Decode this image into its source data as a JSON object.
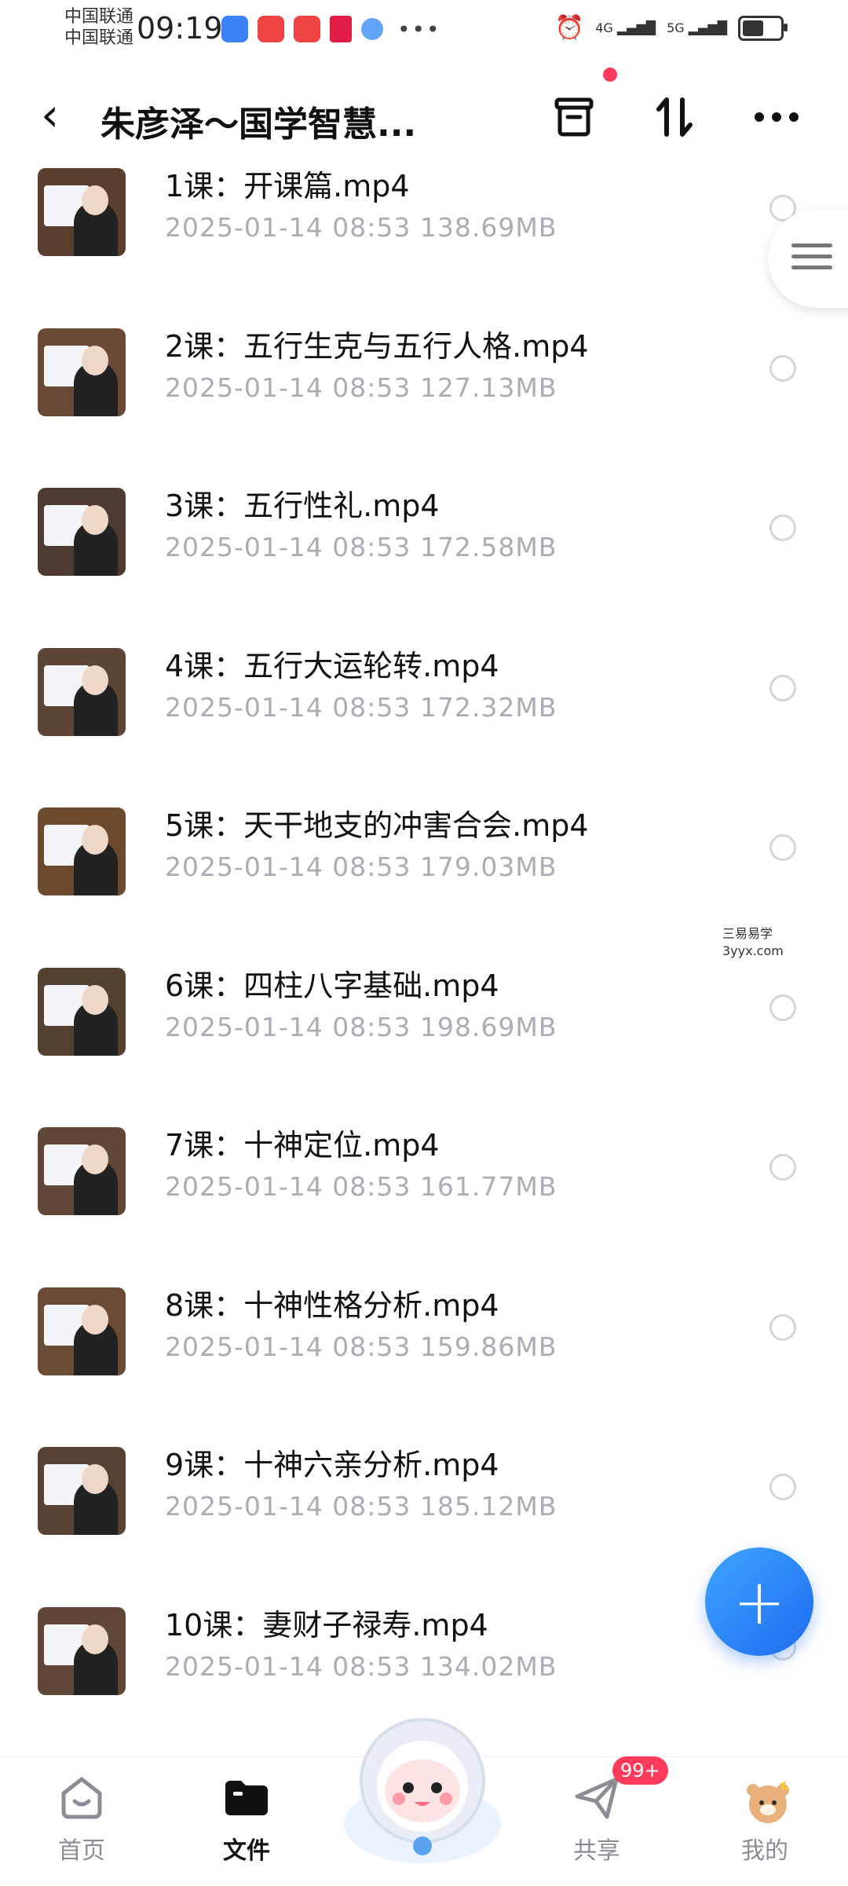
{
  "status_bar": {
    "carrier_1": "中国联通",
    "carrier_2": "中国联通",
    "time": "09:19",
    "signal_1": "4G",
    "signal_2": "5G"
  },
  "header": {
    "title": "朱彦泽～国学智慧..."
  },
  "files": [
    {
      "name": "1课：开课篇.mp4",
      "date": "2025-01-14",
      "time": "08:53",
      "size": "138.69MB"
    },
    {
      "name": "2课：五行生克与五行人格.mp4",
      "date": "2025-01-14",
      "time": "08:53",
      "size": "127.13MB"
    },
    {
      "name": "3课：五行性礼.mp4",
      "date": "2025-01-14",
      "time": "08:53",
      "size": "172.58MB"
    },
    {
      "name": "4课：五行大运轮转.mp4",
      "date": "2025-01-14",
      "time": "08:53",
      "size": "172.32MB"
    },
    {
      "name": "5课：天干地支的冲害合会.mp4",
      "date": "2025-01-14",
      "time": "08:53",
      "size": "179.03MB"
    },
    {
      "name": "6课：四柱八字基础.mp4",
      "date": "2025-01-14",
      "time": "08:53",
      "size": "198.69MB"
    },
    {
      "name": "7课：十神定位.mp4",
      "date": "2025-01-14",
      "time": "08:53",
      "size": "161.77MB"
    },
    {
      "name": "8课：十神性格分析.mp4",
      "date": "2025-01-14",
      "time": "08:53",
      "size": "159.86MB"
    },
    {
      "name": "9课：十神六亲分析.mp4",
      "date": "2025-01-14",
      "time": "08:53",
      "size": "185.12MB"
    },
    {
      "name": "10课：妻财子禄寿.mp4",
      "date": "2025-01-14",
      "time": "08:53",
      "size": "134.02MB"
    }
  ],
  "watermark": {
    "line1": "三易易学",
    "line2": "3yyx.com"
  },
  "fab": {
    "label": "+"
  },
  "bottom_nav": {
    "home": "首页",
    "files": "文件",
    "share": "共享",
    "share_badge": "99+",
    "mine": "我的"
  },
  "colors": {
    "accent": "#1d6bf0",
    "badge": "#ff3b5c"
  }
}
